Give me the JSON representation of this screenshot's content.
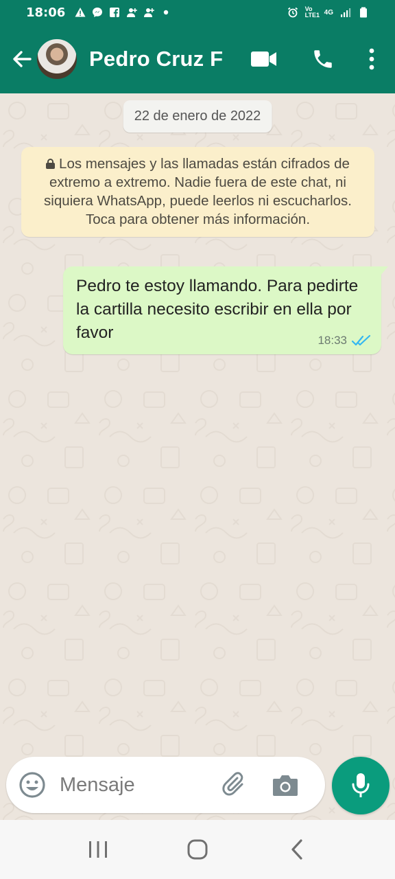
{
  "status_bar": {
    "time": "18:06",
    "icons_left": [
      "warning-icon",
      "messenger-icon",
      "facebook-icon",
      "person-add-icon",
      "person-add-icon",
      "dot-icon"
    ],
    "icons_right": [
      "alarm-icon",
      "volte-icon",
      "4g-icon",
      "signal-icon",
      "battery-icon"
    ],
    "volte_label": "Vo LTE1",
    "network_label": "4G"
  },
  "app_bar": {
    "contact_name": "Pedro Cruz F",
    "color": "#0a7d65"
  },
  "chat": {
    "date_chip": "22 de enero de 2022",
    "encryption_notice": "Los mensajes y las llamadas están cifrados de extremo a extremo. Nadie fuera de este chat, ni siquiera WhatsApp, puede leerlos ni escucharlos. Toca para obtener más información.",
    "messages": [
      {
        "direction": "outgoing",
        "text": "Pedro te estoy llamando.  Para pedirte la cartilla necesito escribir en ella por favor",
        "time": "18:33",
        "status": "read",
        "bubble_color": "#dcf8c6"
      }
    ]
  },
  "input_bar": {
    "placeholder": "Mensaje"
  },
  "colors": {
    "accent": "#0a7d65",
    "mic_button": "#0a9c7d",
    "read_ticks": "#34b7f1",
    "background": "#ece5dd"
  }
}
